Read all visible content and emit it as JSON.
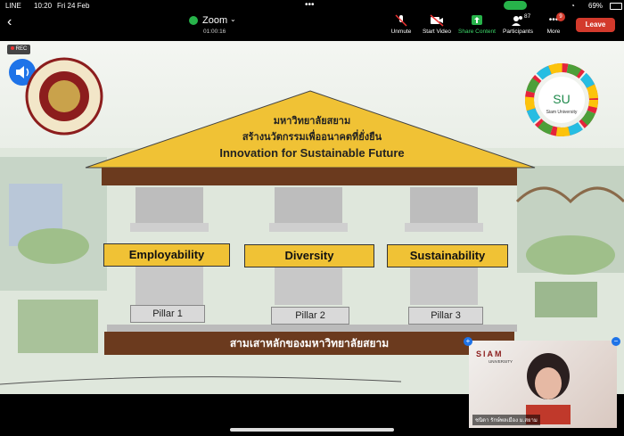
{
  "status_bar": {
    "carrier": "LINE",
    "time": "10:20",
    "date": "Fri 24 Feb",
    "battery": "69%"
  },
  "header": {
    "app_name": "Zoom",
    "elapsed": "01:00:16",
    "buttons": [
      {
        "label": "Unmute"
      },
      {
        "label": "Start Video"
      },
      {
        "label": "Share Content"
      },
      {
        "label": "Participants",
        "count": "87"
      },
      {
        "label": "More",
        "badge": "9"
      }
    ],
    "leave": "Leave"
  },
  "recording": "REC",
  "slide": {
    "title_th_1": "มหาวิทยาลัยสยาม",
    "title_th_2": "สร้างนวัตกรรมเพื่ออนาคตที่ยั่งยืน",
    "title_en": "Innovation for Sustainable Future",
    "themes": [
      "Employability",
      "Diversity",
      "Sustainability"
    ],
    "pillars": [
      "Pillar 1",
      "Pillar 2",
      "Pillar 3"
    ],
    "base": "สามเสาหลักของมหาวิทยาลัยสยาม",
    "su_logo_text": "SU",
    "su_logo_sub": "Siam University",
    "seal_text": "SIAM UNIVERSITY"
  },
  "video": {
    "logo": "SIAM",
    "logo_sub": "UNIVERSITY",
    "participant_name": "ชนิดา รักษ์พลเมือง ม.สยาม"
  },
  "colors": {
    "leave": "#d33a2c",
    "share_green": "#27b34a",
    "roof": "#f0c235",
    "base": "#6b3a1e"
  }
}
